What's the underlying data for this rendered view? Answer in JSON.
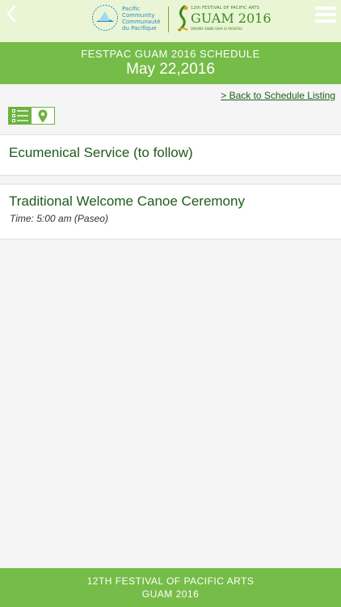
{
  "header": {
    "back_icon": "chevron-left-icon",
    "menu_icon": "hamburger-menu-icon",
    "logo_left": {
      "line1": "Pacific",
      "line2": "Community",
      "line3": "Communauté",
      "line4": "du Pacifique"
    },
    "logo_right": {
      "small": "12th FESTIVAL OF PACIFIC ARTS",
      "big": "GUAM 2016",
      "sub": "DINAÑA SINIBI SIHA GI PASIFIKU"
    }
  },
  "title_band": {
    "subtitle": "FESTPAC GUAM 2016 SCHEDULE",
    "date": "May 22,2016"
  },
  "content": {
    "back_link": "> Back to Schedule Listing",
    "view_toggle": {
      "list_icon": "list-icon",
      "map_icon": "map-pin-icon"
    },
    "events": [
      {
        "title": "Ecumenical Service (to follow)"
      },
      {
        "title": "Traditional Welcome Canoe Ceremony",
        "time": "Time: 5:00 am (Paseo)"
      }
    ]
  },
  "footer": {
    "line1": "12TH FESTIVAL OF PACIFIC ARTS",
    "line2": "GUAM 2016"
  },
  "colors": {
    "brand_green": "#76bc48",
    "header_bg": "#eaf5d6",
    "title_text": "#1f5c1a"
  }
}
